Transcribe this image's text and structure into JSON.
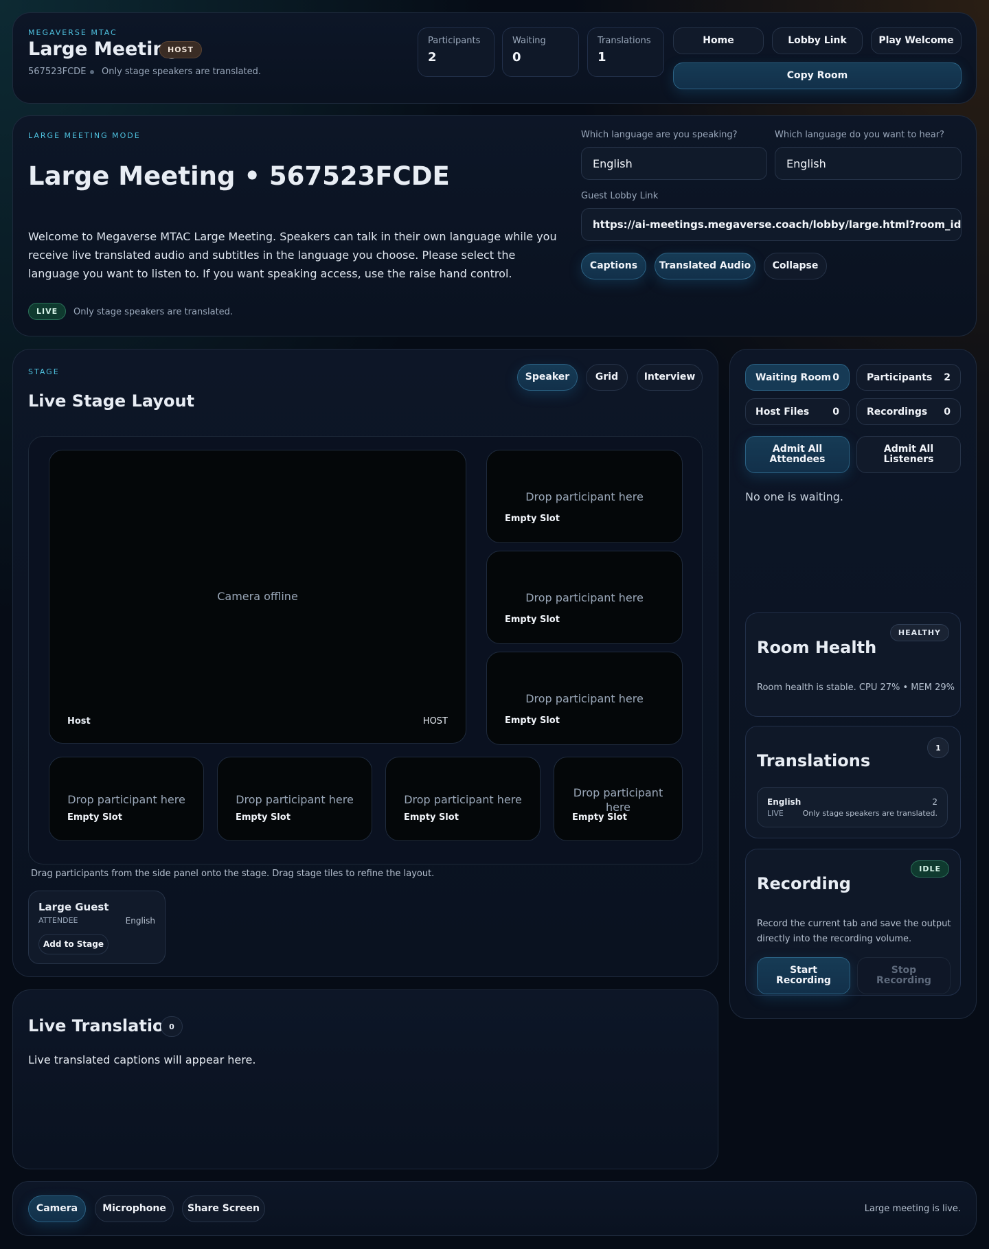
{
  "header": {
    "eyebrow": "MEGAVERSE MTAC",
    "title": "Large Meeting",
    "role_badge": "HOST",
    "room_id": "567523FCDE",
    "note": "Only stage speakers are translated.",
    "stats": [
      {
        "label": "Participants",
        "value": "2"
      },
      {
        "label": "Waiting",
        "value": "0"
      },
      {
        "label": "Translations",
        "value": "1"
      }
    ],
    "buttons": {
      "home": "Home",
      "lobby_link": "Lobby Link",
      "play_welcome": "Play Welcome",
      "copy_room": "Copy Room"
    }
  },
  "intro": {
    "eyebrow": "LARGE MEETING MODE",
    "title": "Large Meeting • 567523FCDE",
    "description": "Welcome to Megaverse MTAC Large Meeting. Speakers can talk in their own language while you receive live translated audio and subtitles in the language you choose. Please select the language you want to listen to. If you want speaking access, use the raise hand control.",
    "live_badge": "LIVE",
    "live_note": "Only stage speakers are translated.",
    "speak_label": "Which language are you speaking?",
    "speak_value": "English",
    "hear_label": "Which language do you want to hear?",
    "hear_value": "English",
    "lobby_label": "Guest Lobby Link",
    "lobby_value": "https://ai-meetings.megaverse.coach/lobby/large.html?room_id=room-",
    "buttons": {
      "captions": "Captions",
      "translated_audio": "Translated Audio",
      "collapse": "Collapse"
    }
  },
  "stage": {
    "eyebrow": "STAGE",
    "title": "Live Stage Layout",
    "layout_buttons": {
      "speaker": "Speaker",
      "grid": "Grid",
      "interview": "Interview"
    },
    "main_tile": {
      "status": "Camera offline",
      "name": "Host",
      "role": "HOST"
    },
    "drop_text": "Drop participant here",
    "empty_slot": "Empty Slot",
    "hint": "Drag participants from the side panel onto the stage. Drag stage tiles to refine the layout.",
    "guest": {
      "name": "Large Guest",
      "role": "ATTENDEE",
      "language": "English",
      "add_button": "Add to Stage"
    }
  },
  "side": {
    "chips": [
      {
        "label": "Waiting Room",
        "count": "0"
      },
      {
        "label": "Participants",
        "count": "2"
      },
      {
        "label": "Host Files",
        "count": "0"
      },
      {
        "label": "Recordings",
        "count": "0"
      }
    ],
    "admit_attendees": "Admit All Attendees",
    "admit_listeners": "Admit All Listeners",
    "waiting_note": "No one is waiting.",
    "health": {
      "title": "Room Health",
      "badge": "HEALTHY",
      "text": "Room health is stable. CPU 27% • MEM 29%"
    },
    "translations": {
      "title": "Translations",
      "count": "1",
      "language": "English",
      "lang_count": "2",
      "status": "LIVE",
      "note": "Only stage speakers are translated."
    },
    "recording": {
      "title": "Recording",
      "badge": "IDLE",
      "text": "Record the current tab and save the output directly into the recording volume.",
      "start": "Start Recording",
      "stop": "Stop Recording"
    }
  },
  "live_translation": {
    "title": "Live Translation",
    "count": "0",
    "placeholder": "Live translated captions will appear here."
  },
  "footer": {
    "camera": "Camera",
    "microphone": "Microphone",
    "share_screen": "Share Screen",
    "status": "Large meeting is live."
  },
  "colors": {
    "accent": "#4fc3e0",
    "primary_button": "#163b55",
    "live_green": "#0f3a2f"
  }
}
